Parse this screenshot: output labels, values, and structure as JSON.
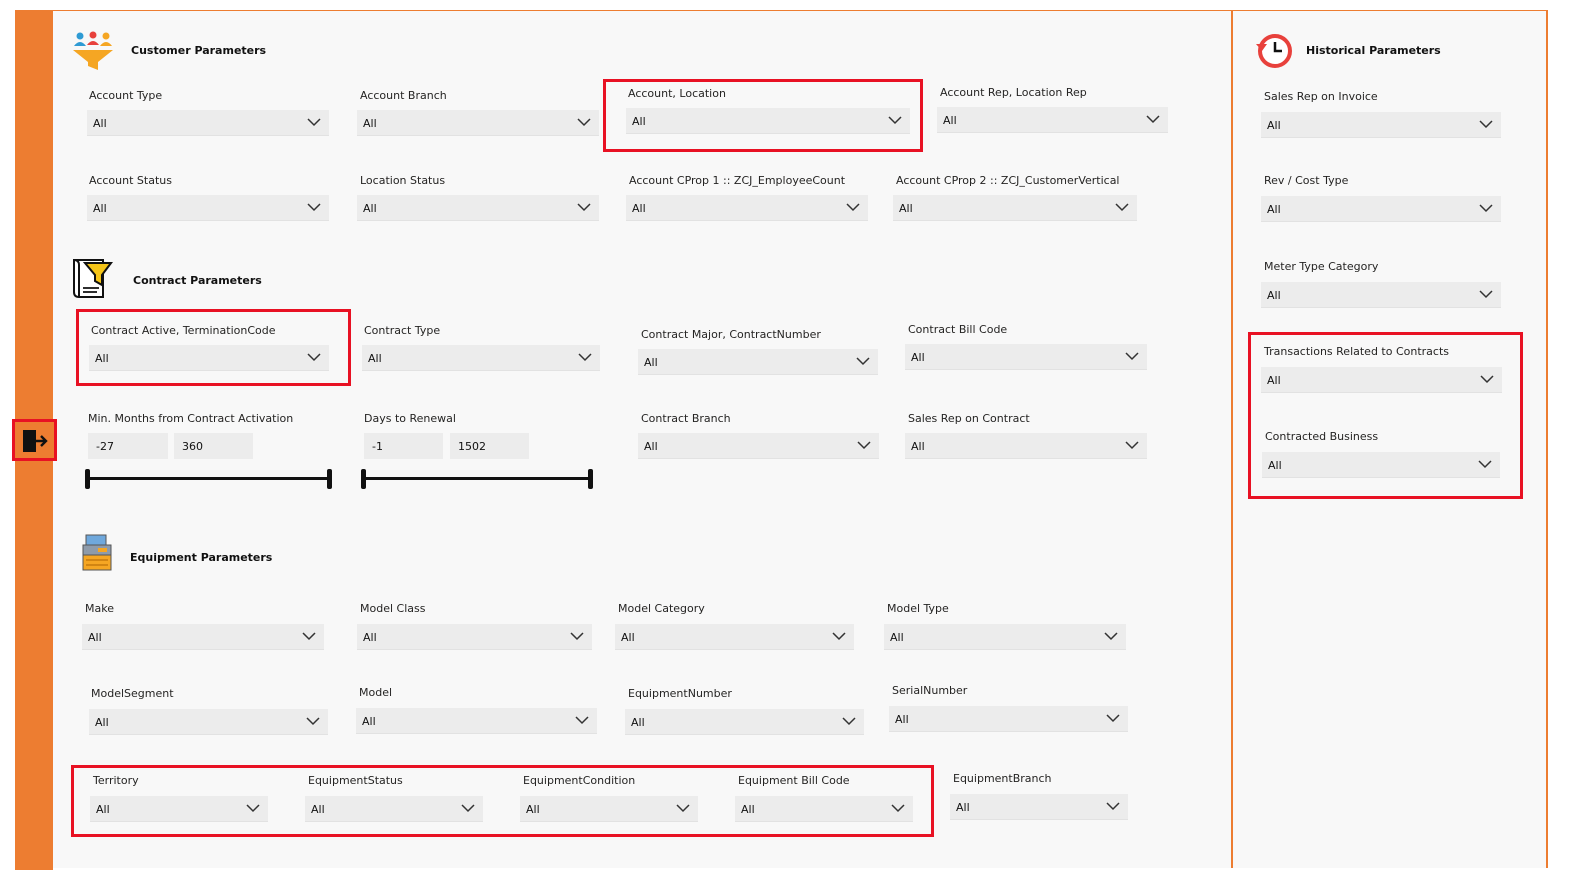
{
  "sections": {
    "customer": "Customer Parameters",
    "contract": "Contract Parameters",
    "equipment": "Equipment Parameters",
    "historical": "Historical Parameters"
  },
  "colors": {
    "accent": "#ED7D31",
    "highlight": "#E81123",
    "panel": "#F8F8F8",
    "dropdown": "#ECECEC"
  },
  "icons": {
    "exit": "exit-arrow-icon",
    "customer": "people-funnel-icon",
    "contract": "scroll-filter-icon",
    "equipment": "printer-icon",
    "historical": "history-clock-icon"
  },
  "customer": {
    "account_type": {
      "label": "Account Type",
      "value": "All"
    },
    "account_branch": {
      "label": "Account Branch",
      "value": "All"
    },
    "account_location": {
      "label": "Account, Location",
      "value": "All"
    },
    "account_rep": {
      "label": "Account Rep, Location Rep",
      "value": "All"
    },
    "account_status": {
      "label": "Account Status",
      "value": "All"
    },
    "location_status": {
      "label": "Location Status",
      "value": "All"
    },
    "cprop1": {
      "label": "Account CProp 1 :: ZCJ_EmployeeCount",
      "value": "All"
    },
    "cprop2": {
      "label": "Account CProp 2 :: ZCJ_CustomerVertical",
      "value": "All"
    }
  },
  "contract": {
    "active_termination": {
      "label": "Contract Active, TerminationCode",
      "value": "All"
    },
    "contract_type": {
      "label": "Contract Type",
      "value": "All"
    },
    "major_number": {
      "label": "Contract Major, ContractNumber",
      "value": "All"
    },
    "bill_code": {
      "label": "Contract Bill Code",
      "value": "All"
    },
    "min_months": {
      "label": "Min. Months from Contract Activation",
      "min": "-27",
      "max": "360"
    },
    "days_renewal": {
      "label": "Days to Renewal",
      "min": "-1",
      "max": "1502"
    },
    "branch": {
      "label": "Contract Branch",
      "value": "All"
    },
    "sales_rep": {
      "label": "Sales Rep on Contract",
      "value": "All"
    }
  },
  "equipment": {
    "make": {
      "label": "Make",
      "value": "All"
    },
    "model_class": {
      "label": "Model Class",
      "value": "All"
    },
    "model_category": {
      "label": "Model Category",
      "value": "All"
    },
    "model_type": {
      "label": "Model Type",
      "value": "All"
    },
    "model_segment": {
      "label": "ModelSegment",
      "value": "All"
    },
    "model": {
      "label": "Model",
      "value": "All"
    },
    "equipment_number": {
      "label": "EquipmentNumber",
      "value": "All"
    },
    "serial_number": {
      "label": "SerialNumber",
      "value": "All"
    },
    "territory": {
      "label": "Territory",
      "value": "All"
    },
    "status": {
      "label": "EquipmentStatus",
      "value": "All"
    },
    "condition": {
      "label": "EquipmentCondition",
      "value": "All"
    },
    "bill_code": {
      "label": "Equipment Bill Code",
      "value": "All"
    },
    "branch": {
      "label": "EquipmentBranch",
      "value": "All"
    }
  },
  "historical": {
    "sales_rep_invoice": {
      "label": "Sales Rep on Invoice",
      "value": "All"
    },
    "rev_cost": {
      "label": "Rev / Cost Type",
      "value": "All"
    },
    "meter_type": {
      "label": "Meter Type Category",
      "value": "All"
    },
    "transactions": {
      "label": "Transactions Related to Contracts",
      "value": "All"
    },
    "contracted_business": {
      "label": "Contracted Business",
      "value": "All"
    }
  }
}
